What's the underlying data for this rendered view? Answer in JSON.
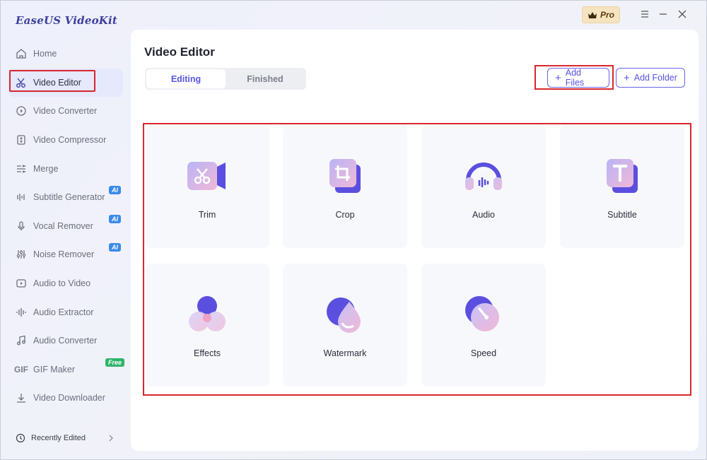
{
  "app": {
    "title": "EaseUS VideoKit",
    "pro_label": "Pro"
  },
  "sidebar": {
    "items": [
      {
        "label": "Home",
        "icon": "home-icon"
      },
      {
        "label": "Video Editor",
        "icon": "scissors-icon",
        "active": true
      },
      {
        "label": "Video Converter",
        "icon": "video-converter-icon"
      },
      {
        "label": "Video Compressor",
        "icon": "compressor-icon"
      },
      {
        "label": "Merge",
        "icon": "merge-icon"
      },
      {
        "label": "Subtitle Generator",
        "icon": "subtitle-generator-icon",
        "tag": "AI"
      },
      {
        "label": "Vocal Remover",
        "icon": "microphone-icon",
        "tag": "AI"
      },
      {
        "label": "Noise Remover",
        "icon": "noise-icon",
        "tag": "AI"
      },
      {
        "label": "Audio to Video",
        "icon": "audio-to-video-icon"
      },
      {
        "label": "Audio Extractor",
        "icon": "audio-extractor-icon"
      },
      {
        "label": "Audio Converter",
        "icon": "music-note-icon"
      },
      {
        "label": "GIF Maker",
        "icon": "gif-icon",
        "icon_text": "GIF",
        "tag": "Free"
      },
      {
        "label": "Video Downloader",
        "icon": "download-icon"
      }
    ],
    "recent_label": "Recently Edited"
  },
  "main": {
    "title": "Video Editor",
    "tabs": [
      {
        "label": "Editing",
        "active": true
      },
      {
        "label": "Finished"
      }
    ],
    "add_files_label": "Add Files",
    "add_folder_label": "Add Folder",
    "tools": [
      {
        "label": "Trim",
        "icon": "trim-icon"
      },
      {
        "label": "Crop",
        "icon": "crop-icon"
      },
      {
        "label": "Audio",
        "icon": "audio-icon"
      },
      {
        "label": "Subtitle",
        "icon": "subtitle-icon"
      },
      {
        "label": "Effects",
        "icon": "effects-icon"
      },
      {
        "label": "Watermark",
        "icon": "watermark-icon"
      },
      {
        "label": "Speed",
        "icon": "speed-icon"
      }
    ]
  },
  "colors": {
    "accent": "#5a52e0",
    "highlight": "#d9262c",
    "ai_tag": "#3a8ae8",
    "free_tag": "#2fb46b"
  }
}
